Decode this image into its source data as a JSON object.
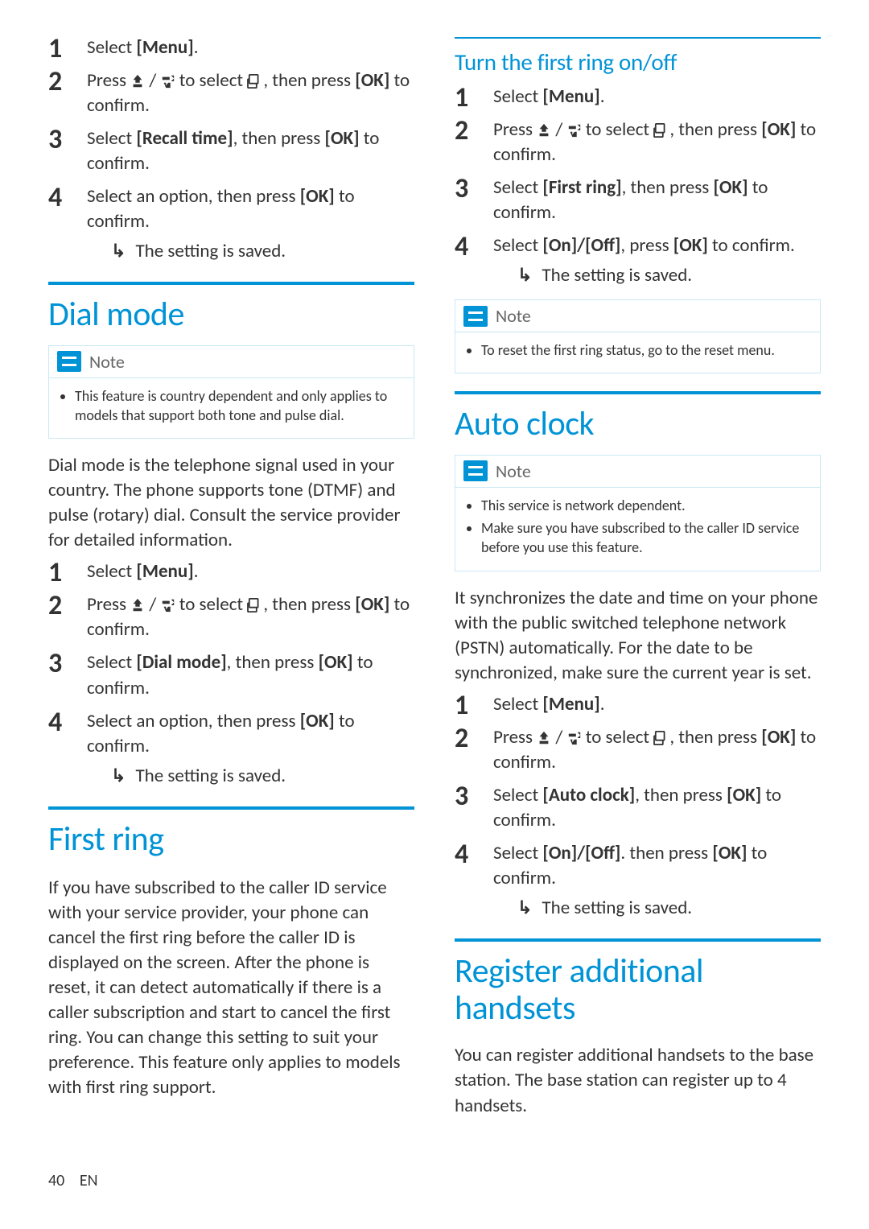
{
  "footer": {
    "page": "40",
    "lang": "EN"
  },
  "labels": {
    "note": "Note",
    "select_menu_pre": "Select ",
    "select_menu_bold": "[Menu]",
    "select_menu_post": ".",
    "press_nav_pre": "Press ",
    "press_nav_mid": " to select ",
    "press_nav_post1": ", then press ",
    "press_nav_ok": "[OK]",
    "press_nav_post2": " to confirm.",
    "setting_saved": "The setting is saved."
  },
  "left": {
    "top_steps": {
      "s1": "Select [Menu].",
      "s3_pre": "Select ",
      "s3_bold": "[Recall time]",
      "s3_mid": ", then press ",
      "s3_ok": "[OK]",
      "s3_post": " to confirm.",
      "s4_pre": "Select an option, then press ",
      "s4_ok": "[OK]",
      "s4_post": " to confirm."
    },
    "dial_mode": {
      "title": "Dial mode",
      "note1": "This feature is country dependent and only applies to models that support both tone and pulse dial.",
      "para": "Dial mode is the telephone signal used in your country. The phone supports tone (DTMF) and pulse (rotary) dial. Consult the service provider for detailed information.",
      "s3_pre": "Select ",
      "s3_bold": "[Dial mode]",
      "s3_mid": ", then press ",
      "s3_ok": "[OK]",
      "s3_post": " to confirm.",
      "s4_pre": "Select an option, then press ",
      "s4_ok": "[OK]",
      "s4_post": " to confirm."
    },
    "first_ring": {
      "title": "First ring",
      "para": "If you have subscribed to the caller ID service with your service provider, your phone can cancel the first ring before the caller ID is displayed on the screen. After the phone is reset, it can detect automatically if there is a caller subscription and start to cancel the first ring. You can change this setting to suit your preference. This feature only applies to models with first ring support."
    }
  },
  "right": {
    "turn_first_ring": {
      "title": "Turn the first ring on/off",
      "s3_pre": "Select ",
      "s3_bold": "[First ring]",
      "s3_mid": ", then press ",
      "s3_ok": "[OK]",
      "s3_post": " to confirm.",
      "s4_pre": "Select ",
      "s4_bold": "[On]/[Off]",
      "s4_mid": ", press ",
      "s4_ok": "[OK]",
      "s4_post": " to confirm.",
      "note1": "To reset the first ring status, go to the reset menu."
    },
    "auto_clock": {
      "title": "Auto clock",
      "note1": "This service is network dependent.",
      "note2": "Make sure you have subscribed to the caller ID service before you use this feature.",
      "para": "It synchronizes the date and time on your phone with the public switched telephone network (PSTN) automatically. For the date to be synchronized, make sure the current year is set.",
      "s3_pre": "Select ",
      "s3_bold": "[Auto clock]",
      "s3_mid": ", then press ",
      "s3_ok": "[OK]",
      "s3_post": " to confirm.",
      "s4_pre": "Select ",
      "s4_bold": "[On]/[Off]",
      "s4_mid": ". then press ",
      "s4_ok": "[OK]",
      "s4_post": " to confirm."
    },
    "register": {
      "title": "Register additional handsets",
      "para": "You can register additional handsets to the base station. The base station can register up to 4 handsets."
    }
  }
}
